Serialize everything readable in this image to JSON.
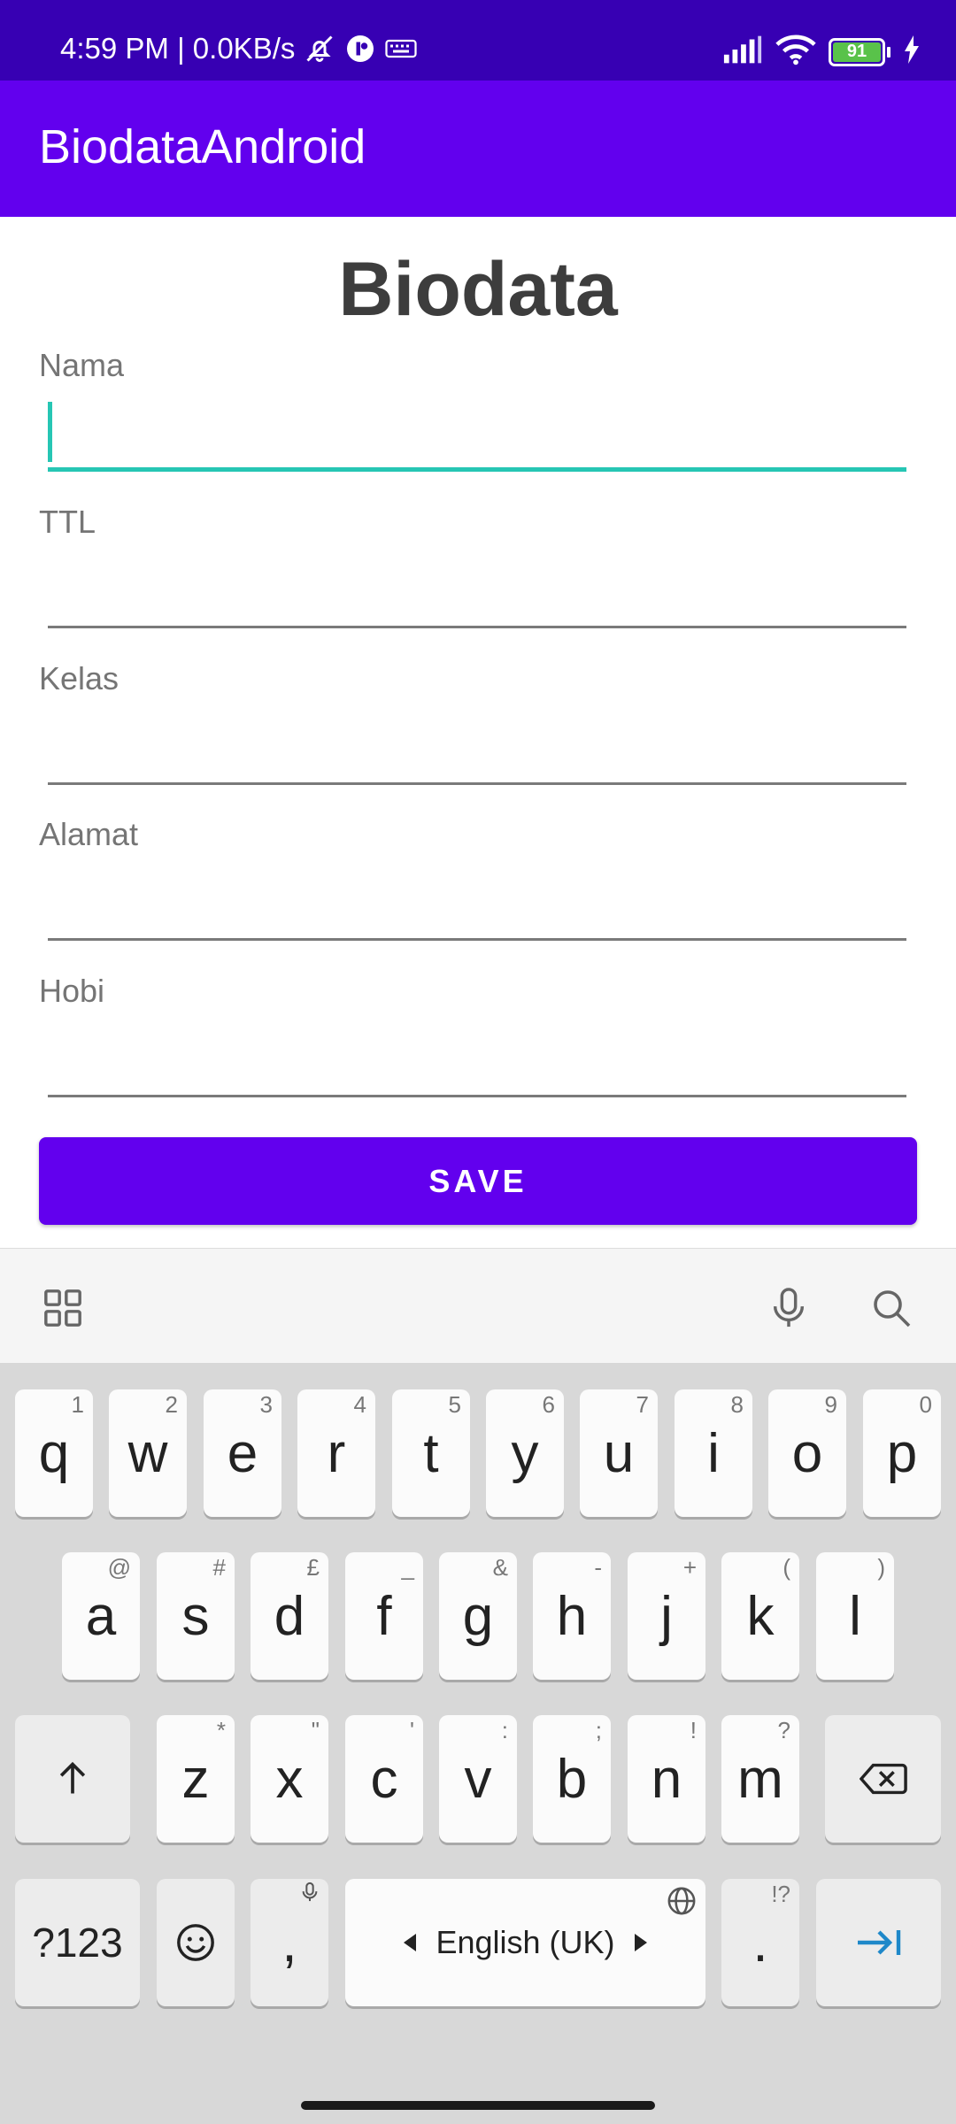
{
  "status_bar": {
    "time_speed": "4:59 PM | 0.0KB/s",
    "battery": "91",
    "icons": [
      "bell-off-icon",
      "app-badge-icon",
      "keyboard-icon",
      "signal-icon",
      "wifi-icon",
      "battery-icon",
      "charging-icon"
    ]
  },
  "app_bar": {
    "title": "BiodataAndroid"
  },
  "colors": {
    "primary": "#6200ee",
    "primary_dark": "#3700b3",
    "accent": "#26c6b4"
  },
  "form": {
    "title": "Biodata",
    "fields": [
      {
        "label": "Nama",
        "value": ""
      },
      {
        "label": "TTL",
        "value": ""
      },
      {
        "label": "Kelas",
        "value": ""
      },
      {
        "label": "Alamat",
        "value": ""
      },
      {
        "label": "Hobi",
        "value": ""
      }
    ],
    "save_label": "SAVE"
  },
  "keyboard": {
    "toolbar_icons": [
      "apps-grid-icon",
      "microphone-icon",
      "search-icon"
    ],
    "row1": [
      {
        "key": "q",
        "hint": "1"
      },
      {
        "key": "w",
        "hint": "2"
      },
      {
        "key": "e",
        "hint": "3"
      },
      {
        "key": "r",
        "hint": "4"
      },
      {
        "key": "t",
        "hint": "5"
      },
      {
        "key": "y",
        "hint": "6"
      },
      {
        "key": "u",
        "hint": "7"
      },
      {
        "key": "i",
        "hint": "8"
      },
      {
        "key": "o",
        "hint": "9"
      },
      {
        "key": "p",
        "hint": "0"
      }
    ],
    "row2": [
      {
        "key": "a",
        "hint": "@"
      },
      {
        "key": "s",
        "hint": "#"
      },
      {
        "key": "d",
        "hint": "£"
      },
      {
        "key": "f",
        "hint": "_"
      },
      {
        "key": "g",
        "hint": "&"
      },
      {
        "key": "h",
        "hint": "-"
      },
      {
        "key": "j",
        "hint": "+"
      },
      {
        "key": "k",
        "hint": "("
      },
      {
        "key": "l",
        "hint": ")"
      }
    ],
    "row3": [
      {
        "key": "z",
        "hint": "*"
      },
      {
        "key": "x",
        "hint": "\""
      },
      {
        "key": "c",
        "hint": "'"
      },
      {
        "key": "v",
        "hint": ":"
      },
      {
        "key": "b",
        "hint": ";"
      },
      {
        "key": "n",
        "hint": "!"
      },
      {
        "key": "m",
        "hint": "?"
      }
    ],
    "symbols_label": "?123",
    "comma": ",",
    "period": ".",
    "period_hint": "!?",
    "space_label": "English (UK)"
  }
}
